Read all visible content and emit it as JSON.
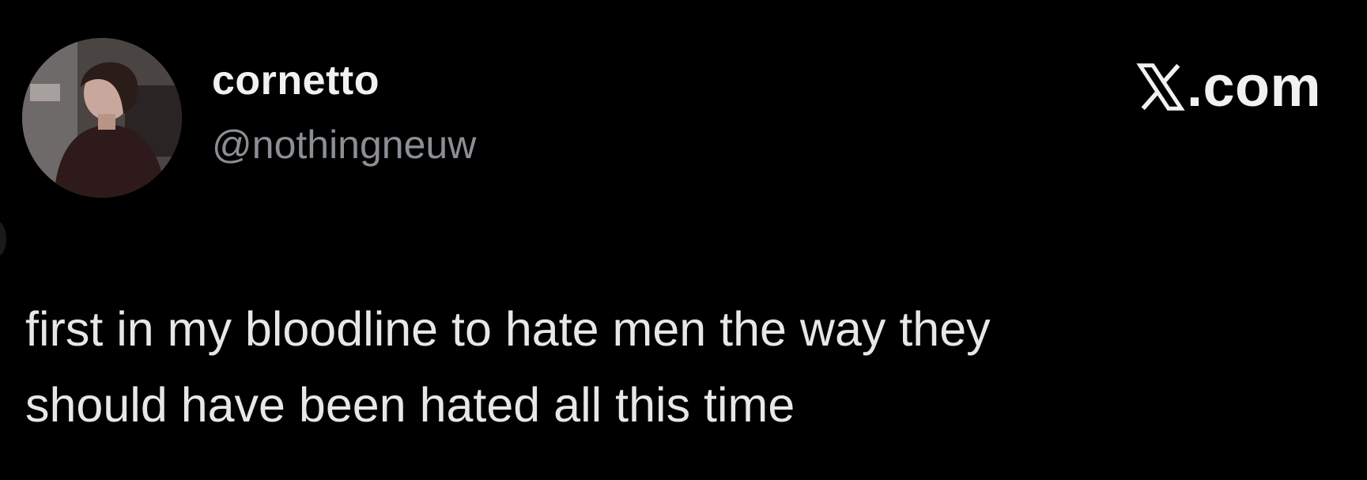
{
  "post": {
    "author_name": "cornetto",
    "author_handle": "@nothingneuw",
    "text": "first in my bloodline to hate men the way they\nshould have been hated all this time"
  },
  "brand": {
    "text": ".com",
    "icon": "x-logo-icon"
  },
  "colors": {
    "background": "#000000",
    "name": "#f1f1f1",
    "handle": "#8b8f94",
    "body_text": "#e7e7e7"
  }
}
